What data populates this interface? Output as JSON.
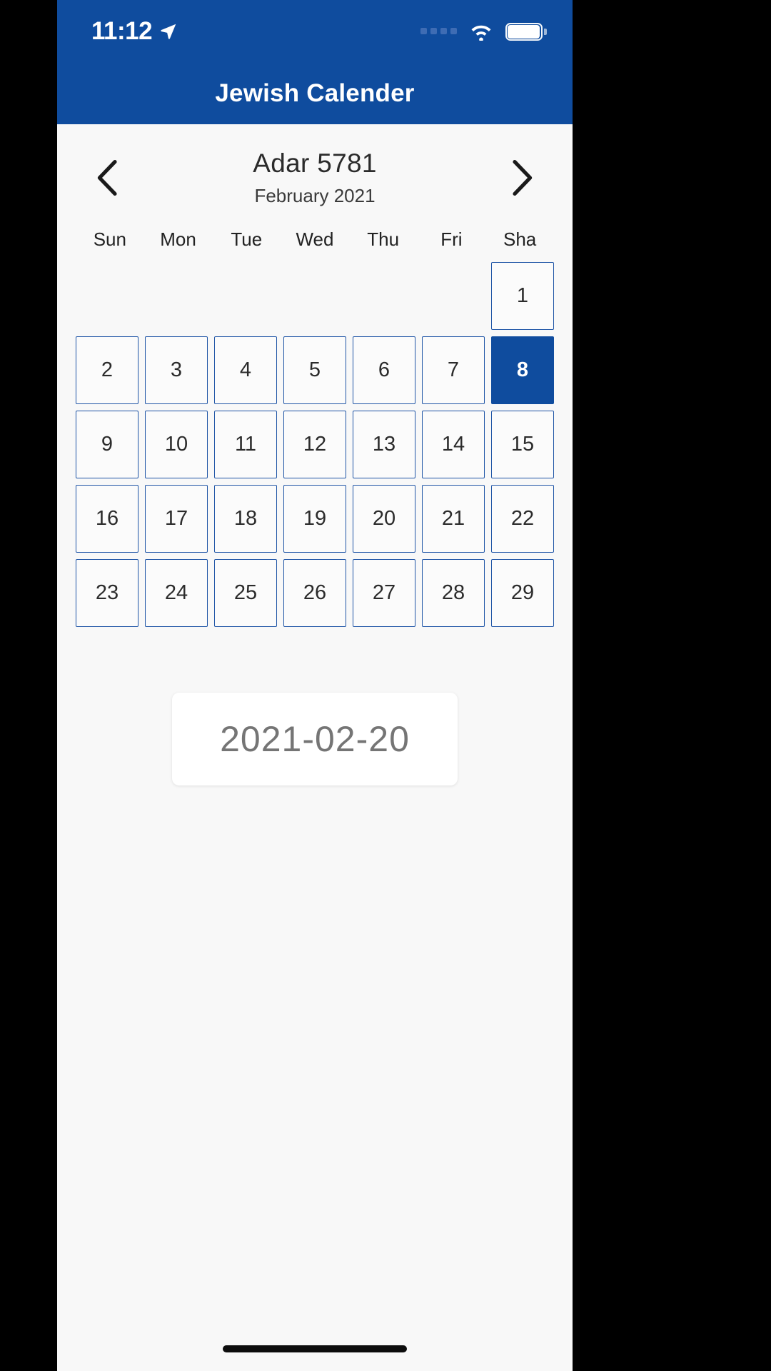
{
  "status_bar": {
    "time": "11:12",
    "location_icon": "location-arrow-icon",
    "signal_icon": "cellular-signal-icon",
    "wifi_icon": "wifi-icon",
    "battery_icon": "battery-full-icon"
  },
  "app_bar": {
    "title": "Jewish Calender"
  },
  "calendar": {
    "prev_label": "‹",
    "next_label": "›",
    "hebrew_month": "Adar 5781",
    "gregorian_month": "February 2021",
    "weekdays": [
      "Sun",
      "Mon",
      "Tue",
      "Wed",
      "Thu",
      "Fri",
      "Sha"
    ],
    "leading_blanks": 6,
    "days": [
      "1",
      "2",
      "3",
      "4",
      "5",
      "6",
      "7",
      "8",
      "9",
      "10",
      "11",
      "12",
      "13",
      "14",
      "15",
      "16",
      "17",
      "18",
      "19",
      "20",
      "21",
      "22",
      "23",
      "24",
      "25",
      "26",
      "27",
      "28",
      "29"
    ],
    "selected_day": "8"
  },
  "date_card": {
    "value": "2021-02-20"
  },
  "colors": {
    "brand_blue": "#0f4c9e",
    "cell_border": "#1f55a6",
    "page_bg": "#f8f8f8",
    "date_text": "#757575"
  }
}
